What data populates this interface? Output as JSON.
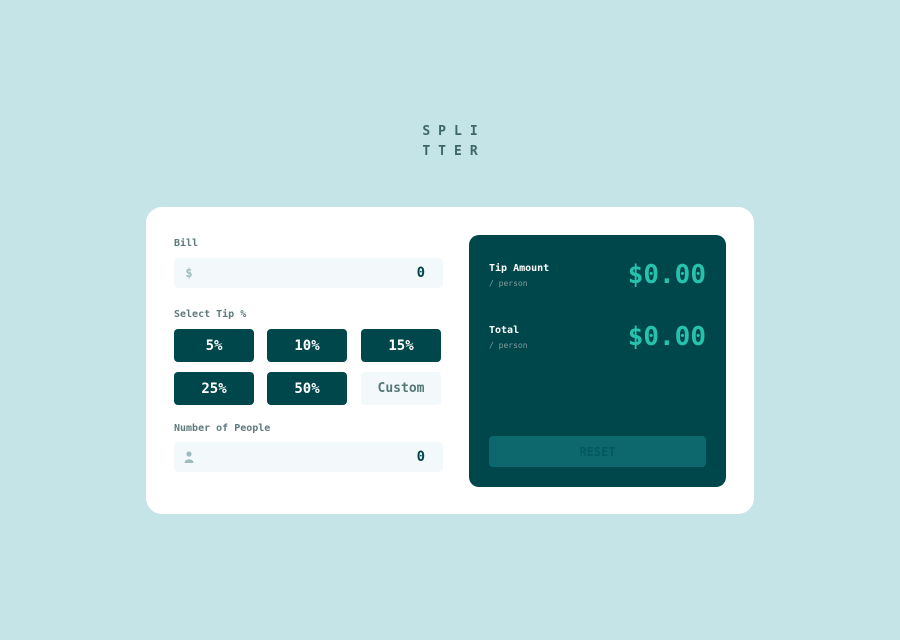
{
  "logo": {
    "line1": "SPLI",
    "line2": "TTER"
  },
  "bill": {
    "label": "Bill",
    "icon": "dollar-icon",
    "icon_glyph": "$",
    "value": "0"
  },
  "tip": {
    "label": "Select Tip %",
    "options": [
      "5%",
      "10%",
      "15%",
      "25%",
      "50%"
    ],
    "custom_placeholder": "Custom"
  },
  "people": {
    "label": "Number of People",
    "icon": "person-icon",
    "value": "0"
  },
  "results": {
    "tip_amount": {
      "title": "Tip Amount",
      "sub": "/ person",
      "value": "$0.00"
    },
    "total": {
      "title": "Total",
      "sub": "/ person",
      "value": "$0.00"
    },
    "reset_label": "RESET"
  },
  "colors": {
    "background": "#c5e4e7",
    "panel": "#00474b",
    "accent": "#26c2ae",
    "input_bg": "#f3f9fa",
    "reset_disabled": "#0d686d"
  }
}
